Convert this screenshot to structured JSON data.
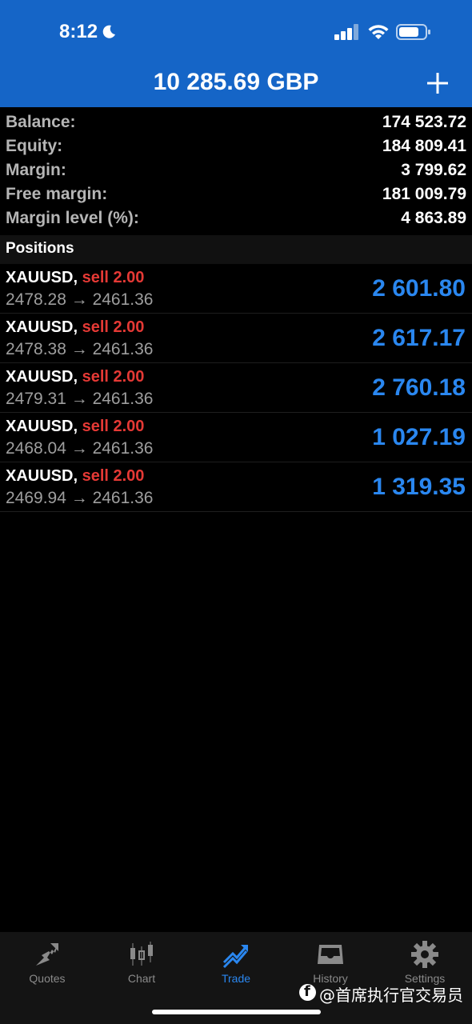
{
  "status_bar": {
    "time": "8:12"
  },
  "header": {
    "title": "10 285.69 GBP"
  },
  "summary": [
    {
      "label": "Balance:",
      "value": "174 523.72"
    },
    {
      "label": "Equity:",
      "value": "184 809.41"
    },
    {
      "label": "Margin:",
      "value": "3 799.62"
    },
    {
      "label": "Free margin:",
      "value": "181 009.79"
    },
    {
      "label": "Margin level (%):",
      "value": "4 863.89"
    }
  ],
  "positions": {
    "title": "Positions",
    "items": [
      {
        "symbol": "XAUUSD,",
        "side": "sell 2.00",
        "prices": "2478.28 → 2461.36",
        "profit": "2 601.80"
      },
      {
        "symbol": "XAUUSD,",
        "side": "sell 2.00",
        "prices": "2478.38 → 2461.36",
        "profit": "2 617.17"
      },
      {
        "symbol": "XAUUSD,",
        "side": "sell 2.00",
        "prices": "2479.31 → 2461.36",
        "profit": "2 760.18"
      },
      {
        "symbol": "XAUUSD,",
        "side": "sell 2.00",
        "prices": "2468.04 → 2461.36",
        "profit": "1 027.19"
      },
      {
        "symbol": "XAUUSD,",
        "side": "sell 2.00",
        "prices": "2469.94 → 2461.36",
        "profit": "1 319.35"
      }
    ]
  },
  "tabs": [
    {
      "label": "Quotes",
      "icon": "quotes-icon"
    },
    {
      "label": "Chart",
      "icon": "chart-icon"
    },
    {
      "label": "Trade",
      "icon": "trade-icon",
      "active": true
    },
    {
      "label": "History",
      "icon": "history-icon"
    },
    {
      "label": "Settings",
      "icon": "settings-icon"
    }
  ],
  "watermark": "@首席执行官交易员",
  "colors": {
    "header_bg": "#1565c7",
    "sell": "#e53935",
    "profit": "#2a87f0",
    "active_tab": "#2a87f0"
  }
}
